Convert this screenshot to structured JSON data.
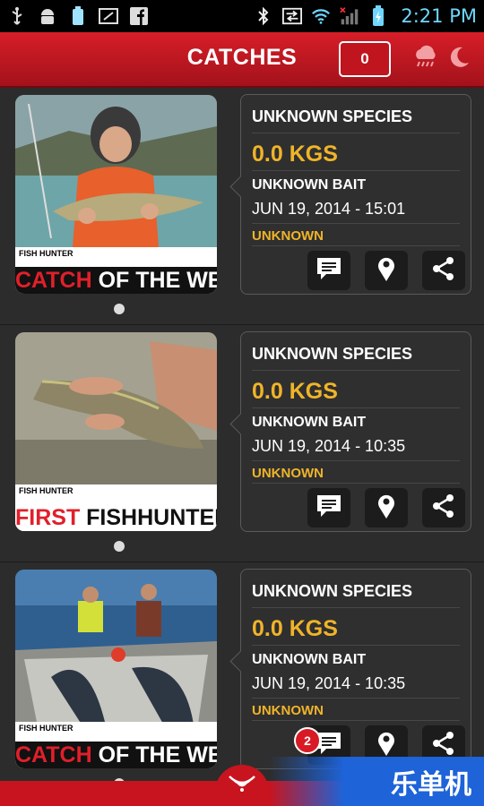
{
  "status_bar": {
    "time": "2:21 PM",
    "left_icons": [
      "usb-icon",
      "android-debug-icon",
      "battery-saver-icon",
      "screen-icon",
      "facebook-icon"
    ],
    "right_icons": [
      "bluetooth-icon",
      "data-transfer-icon",
      "wifi-icon",
      "signal-icon",
      "battery-charging-icon"
    ]
  },
  "appbar": {
    "title": "CATCHES",
    "counter": "0",
    "icons": [
      "weather-rain-icon",
      "moon-icon"
    ]
  },
  "catches": [
    {
      "species": "UNKNOWN SPECIES",
      "weight": "0.0 KGS",
      "bait": "UNKNOWN BAIT",
      "date": "JUN 19, 2014 -  15:01",
      "location": "UNKNOWN",
      "banner_small": "FISH HUNTER",
      "banner_red": "CATCH",
      "banner_white": " OF THE WEEK",
      "comments_badge": ""
    },
    {
      "species": "UNKNOWN SPECIES",
      "weight": "0.0 KGS",
      "bait": "UNKNOWN BAIT",
      "date": "JUN 19, 2014 -  10:35",
      "location": "UNKNOWN",
      "banner_small": "FISH HUNTER",
      "banner_red": "FIRST",
      "banner_white": " FISHHUNTER CATCH",
      "comments_badge": ""
    },
    {
      "species": "UNKNOWN SPECIES",
      "weight": "0.0 KGS",
      "bait": "UNKNOWN BAIT",
      "date": "JUN 19, 2014 -  10:35",
      "location": "UNKNOWN",
      "banner_small": "FISH HUNTER",
      "banner_red": "CATCH",
      "banner_white": " OF THE WEEK",
      "comments_badge": "2"
    }
  ],
  "watermark": "乐单机",
  "colors": {
    "accent_red": "#c8141e",
    "weight_yellow": "#f0b429"
  }
}
